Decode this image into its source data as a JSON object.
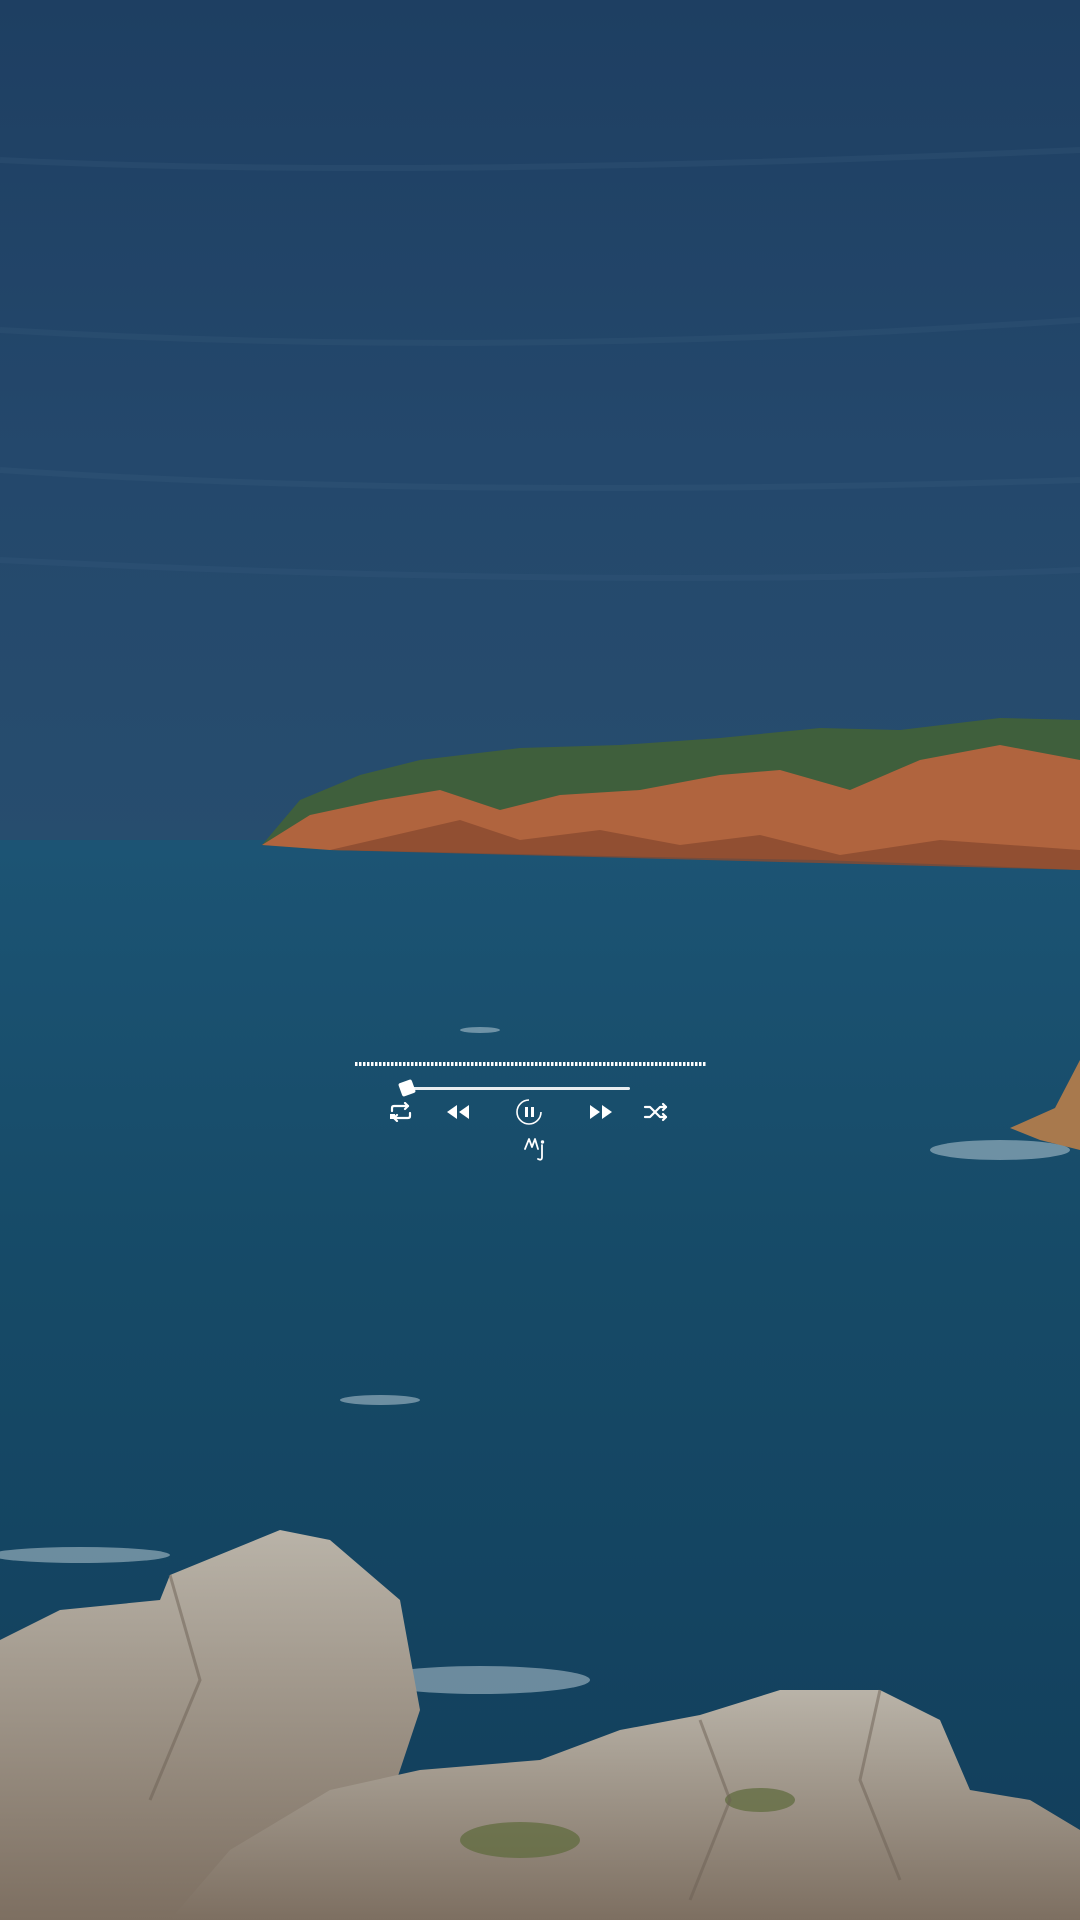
{
  "background": {
    "description_icon": "coastal-seascape-image",
    "sky_color": "#23466b",
    "sea_color": "#164a67",
    "cliff_color": "#b0643e",
    "rock_color": "#b5aea3"
  },
  "player": {
    "progress_fraction": 0.0,
    "controls": [
      "repeat-icon",
      "rewind-icon",
      "pause-icon",
      "fast-forward-icon",
      "shuffle-icon"
    ],
    "signature": "Mj",
    "accent": "#ffffff"
  }
}
